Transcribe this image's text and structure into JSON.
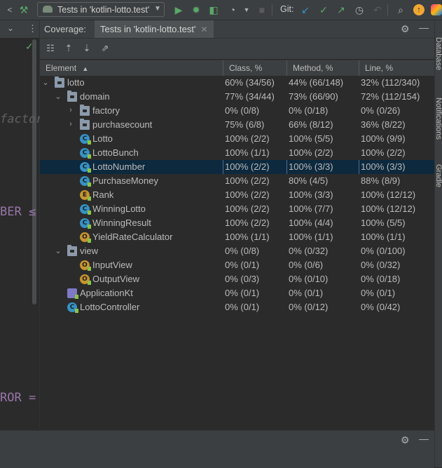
{
  "toolbar": {
    "run_config_label": "Tests in 'kotlin-lotto.test'",
    "git_label": "Git:",
    "icons": [
      "hammer-icon",
      "run-config-icon",
      "run-icon",
      "debug-icon",
      "coverage-icon",
      "profile-icon",
      "stop-icon",
      "git-update-icon",
      "git-commit-icon",
      "git-push-icon",
      "history-icon",
      "rollback-icon",
      "search-icon",
      "update-icon",
      "jetbrains-icon"
    ]
  },
  "editor": {
    "fragments": [
      "factor",
      "BER ≤",
      "ROR ="
    ]
  },
  "coverage": {
    "title": "Coverage:",
    "tab_label": "Tests in 'kotlin-lotto.test'",
    "tab_close": "✕"
  },
  "table": {
    "columns": [
      "Element",
      "Class, %",
      "Method, %",
      "Line, %"
    ],
    "sort_indicator": "▲",
    "rows": [
      {
        "name": "lotto",
        "icon": "folder",
        "class": "60% (34/56)",
        "method": "44% (66/148)",
        "line": "32% (112/340)"
      },
      {
        "name": "domain",
        "icon": "folder",
        "class": "77% (34/44)",
        "method": "73% (66/90)",
        "line": "72% (112/154)"
      },
      {
        "name": "factory",
        "icon": "folder",
        "class": "0% (0/8)",
        "method": "0% (0/18)",
        "line": "0% (0/26)"
      },
      {
        "name": "purchasecount",
        "icon": "folder",
        "class": "75% (6/8)",
        "method": "66% (8/12)",
        "line": "36% (8/22)"
      },
      {
        "name": "Lotto",
        "icon": "class",
        "class": "100% (2/2)",
        "method": "100% (5/5)",
        "line": "100% (9/9)"
      },
      {
        "name": "LottoBunch",
        "icon": "class",
        "class": "100% (1/1)",
        "method": "100% (2/2)",
        "line": "100% (2/2)"
      },
      {
        "name": "LottoNumber",
        "icon": "class",
        "class": "100% (2/2)",
        "method": "100% (3/3)",
        "line": "100% (3/3)"
      },
      {
        "name": "PurchaseMoney",
        "icon": "class",
        "class": "100% (2/2)",
        "method": "80% (4/5)",
        "line": "88% (8/9)"
      },
      {
        "name": "Rank",
        "icon": "enum",
        "class": "100% (2/2)",
        "method": "100% (3/3)",
        "line": "100% (12/12)"
      },
      {
        "name": "WinningLotto",
        "icon": "class",
        "class": "100% (2/2)",
        "method": "100% (7/7)",
        "line": "100% (12/12)"
      },
      {
        "name": "WinningResult",
        "icon": "class",
        "class": "100% (2/2)",
        "method": "100% (4/4)",
        "line": "100% (5/5)"
      },
      {
        "name": "YieldRateCalculator",
        "icon": "object",
        "class": "100% (1/1)",
        "method": "100% (1/1)",
        "line": "100% (1/1)"
      },
      {
        "name": "view",
        "icon": "folder",
        "class": "0% (0/8)",
        "method": "0% (0/32)",
        "line": "0% (0/100)"
      },
      {
        "name": "InputView",
        "icon": "object",
        "class": "0% (0/1)",
        "method": "0% (0/6)",
        "line": "0% (0/32)"
      },
      {
        "name": "OutputView",
        "icon": "object",
        "class": "0% (0/3)",
        "method": "0% (0/10)",
        "line": "0% (0/18)"
      },
      {
        "name": "ApplicationKt",
        "icon": "kotlin-file",
        "class": "0% (0/1)",
        "method": "0% (0/1)",
        "line": "0% (0/1)"
      },
      {
        "name": "LottoController",
        "icon": "class",
        "class": "0% (0/1)",
        "method": "0% (0/12)",
        "line": "0% (0/42)"
      }
    ]
  },
  "right_sidebar": {
    "tabs": [
      "Database",
      "Notifications",
      "Gradle"
    ]
  },
  "colors": {
    "selection": "#0d293e",
    "run_green": "#59a869",
    "git_blue": "#3592c4",
    "update_orange": "#f0a732"
  }
}
